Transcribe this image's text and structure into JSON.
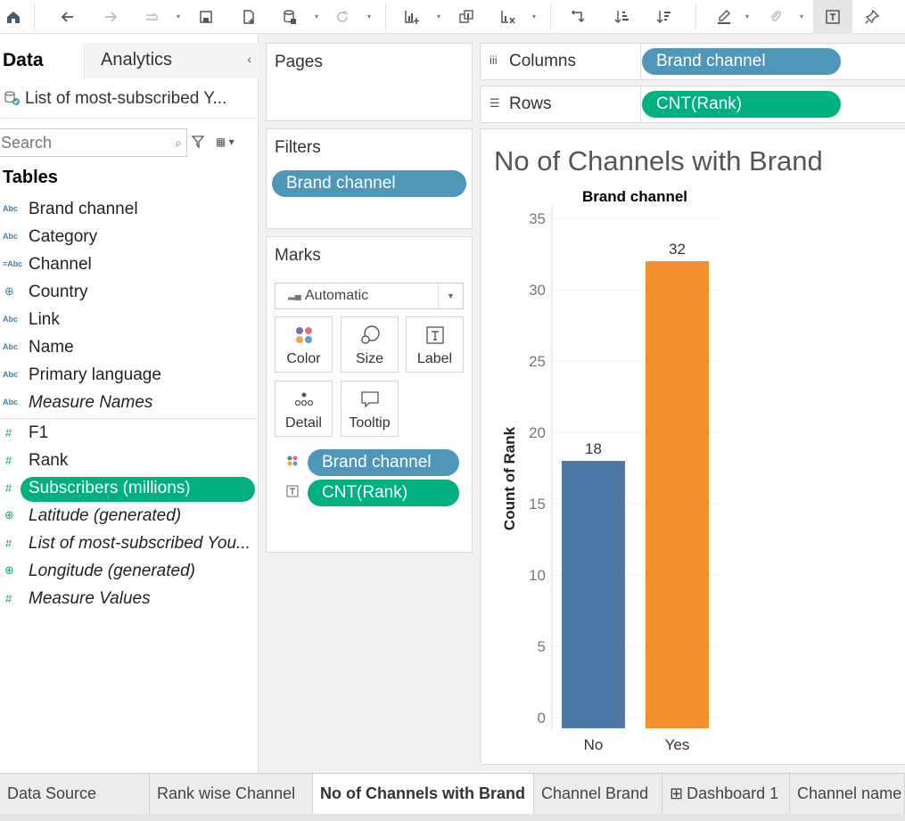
{
  "data_pane": {
    "tab_data": "Data",
    "tab_analytics": "Analytics",
    "datasource": "List of most-subscribed Y...",
    "search_placeholder": "Search",
    "tables_title": "Tables",
    "dimensions": [
      {
        "type": "Abc",
        "name": "Brand channel"
      },
      {
        "type": "Abc",
        "name": "Category"
      },
      {
        "type": "=Abc",
        "name": "Channel"
      },
      {
        "type": "geo",
        "name": "Country"
      },
      {
        "type": "Abc",
        "name": "Link"
      },
      {
        "type": "Abc",
        "name": "Name"
      },
      {
        "type": "Abc",
        "name": "Primary language"
      },
      {
        "type": "Abc",
        "name": "Measure Names"
      }
    ],
    "measures": [
      {
        "type": "#",
        "name": "F1"
      },
      {
        "type": "#",
        "name": "Rank"
      },
      {
        "type": "#",
        "name": "Subscribers (millions)"
      },
      {
        "type": "geo",
        "name": "Latitude (generated)"
      },
      {
        "type": "#",
        "name": "List of most-subscribed You..."
      },
      {
        "type": "geo",
        "name": "Longitude (generated)"
      },
      {
        "type": "#",
        "name": "Measure Values"
      }
    ]
  },
  "pages": {
    "title": "Pages"
  },
  "filters": {
    "title": "Filters",
    "pill": "Brand channel"
  },
  "marks": {
    "title": "Marks",
    "mark_type": "Automatic",
    "buttons": {
      "color": "Color",
      "size": "Size",
      "label": "Label",
      "detail": "Detail",
      "tooltip": "Tooltip"
    },
    "fields": [
      {
        "name": "Brand channel"
      },
      {
        "name": "CNT(Rank)"
      }
    ]
  },
  "columns": {
    "label": "Columns",
    "pill": "Brand channel"
  },
  "rows": {
    "label": "Rows",
    "pill": "CNT(Rank)"
  },
  "view": {
    "title": "No of Channels with Brand"
  },
  "chart_data": {
    "type": "bar",
    "header": "Brand channel",
    "categories": [
      "No",
      "Yes"
    ],
    "values": [
      18,
      32
    ],
    "colors": [
      "#4e79a7",
      "#f28e2b"
    ],
    "ylabel": "Count of Rank",
    "yticks": [
      0,
      5,
      10,
      15,
      20,
      25,
      30,
      35
    ],
    "ylim": [
      0,
      35
    ]
  },
  "tabs": [
    {
      "label": "Data Source",
      "icon": ""
    },
    {
      "label": "Rank wise Channel",
      "icon": ""
    },
    {
      "label": "No of Channels with Brand",
      "icon": "",
      "active": true
    },
    {
      "label": "Channel Brand",
      "icon": ""
    },
    {
      "label": "Dashboard 1",
      "icon": "⊞"
    },
    {
      "label": "Channel name",
      "icon": ""
    }
  ],
  "icons": {
    "dimension_color": "#4e97b8",
    "measure_color": "#00b07f"
  }
}
